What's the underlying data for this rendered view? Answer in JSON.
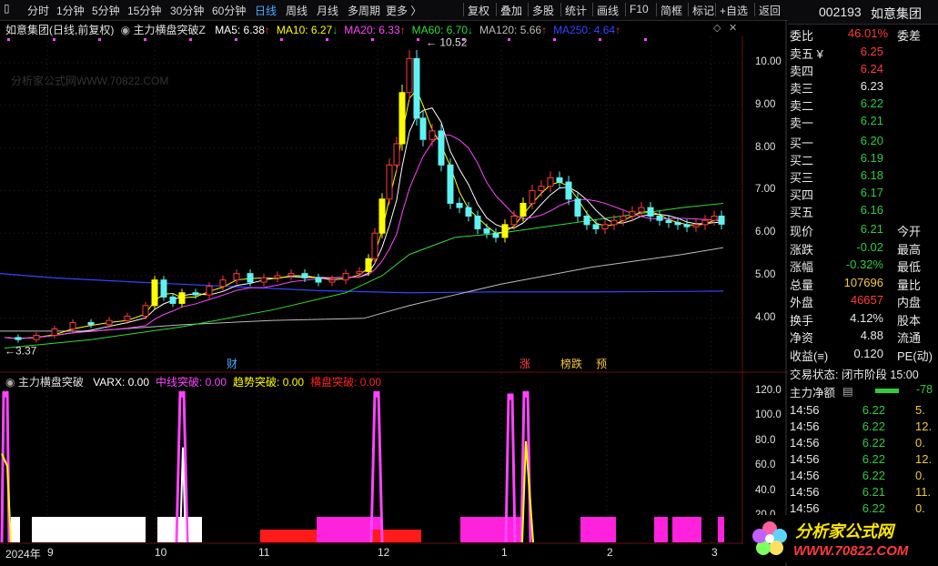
{
  "toolbar": {
    "items": [
      "分时",
      "1分钟",
      "5分钟",
      "15分钟",
      "30分钟",
      "60分钟",
      "日线",
      "周线",
      "月线",
      "多周期",
      "更多 〉"
    ],
    "active": "日线",
    "right_items": [
      "复权",
      "叠加",
      "多股",
      "统计",
      "画线",
      "F10",
      "简框",
      "标记",
      "+自选",
      "返回"
    ]
  },
  "stock": {
    "code": "002193",
    "name": "如意集团"
  },
  "main_chart": {
    "title": "如意集团(日线,前复权)",
    "indicator": "主力横盘突破Z",
    "ma": [
      {
        "label": "MA5: 6.38",
        "arrow": "↑",
        "color": "#ffffff"
      },
      {
        "label": "MA10: 6.27",
        "arrow": "↓",
        "color": "#ffff00"
      },
      {
        "label": "MA20: 6.33",
        "arrow": "↑",
        "color": "#ff44ff"
      },
      {
        "label": "MA60: 6.70",
        "arrow": "↓",
        "color": "#33dd33"
      },
      {
        "label": "MA120: 5.66",
        "arrow": "↑",
        "color": "#bbbbbb"
      },
      {
        "label": "MA250: 4.64",
        "arrow": "↑",
        "color": "#3344ff"
      }
    ],
    "watermark": "分析家公式网WWW.70822.COM",
    "high_label": "10.52",
    "low_label": "3.37",
    "markers": [
      {
        "text": "财",
        "color": "#4aa8ff"
      },
      {
        "text": "涨",
        "color": "#ff4444"
      },
      {
        "text": "榜跌",
        "color": "#f5c842"
      },
      {
        "text": "预",
        "color": "#f5c842"
      }
    ]
  },
  "price_axis": [
    "10.00",
    "9.00",
    "8.00",
    "7.00",
    "6.00",
    "5.00",
    "4.00"
  ],
  "sub_chart": {
    "name": "主力横盘突破",
    "items": [
      {
        "label": "VARX: 0.00",
        "color": "#ffffff"
      },
      {
        "label": "中线突破: 0.00",
        "color": "#ff44ff"
      },
      {
        "label": "趋势突破: 0.00",
        "color": "#ffff00"
      },
      {
        "label": "横盘突破: 0.00",
        "color": "#ff2222"
      }
    ],
    "axis": [
      "120.0",
      "100.0",
      "80.0",
      "60.0",
      "40.0",
      "20.0"
    ]
  },
  "date_axis": [
    "2024年",
    "9",
    "10",
    "11",
    "12",
    "1",
    "2",
    "3"
  ],
  "quote": {
    "webi_label": "委比",
    "webi_value": "46.01%",
    "weicha_label": "委差",
    "sells": [
      {
        "label": "卖五",
        "mark": "¥",
        "price": "6.25",
        "cls": "red"
      },
      {
        "label": "卖四",
        "mark": "",
        "price": "6.24",
        "cls": "red"
      },
      {
        "label": "卖三",
        "mark": "",
        "price": "6.23",
        "cls": "wht"
      },
      {
        "label": "卖二",
        "mark": "",
        "price": "6.22",
        "cls": "grn"
      },
      {
        "label": "卖一",
        "mark": "",
        "price": "6.21",
        "cls": "grn"
      }
    ],
    "buys": [
      {
        "label": "买一",
        "price": "6.20",
        "cls": "grn"
      },
      {
        "label": "买二",
        "price": "6.19",
        "cls": "grn"
      },
      {
        "label": "买三",
        "price": "6.18",
        "cls": "grn"
      },
      {
        "label": "买四",
        "price": "6.17",
        "cls": "grn"
      },
      {
        "label": "买五",
        "price": "6.16",
        "cls": "grn"
      }
    ],
    "stats": [
      {
        "label": "现价",
        "value": "6.21",
        "cls": "grn",
        "label2": "今开"
      },
      {
        "label": "涨跌",
        "value": "-0.02",
        "cls": "grn",
        "label2": "最高"
      },
      {
        "label": "涨幅",
        "value": "-0.32%",
        "cls": "grn",
        "label2": "最低"
      },
      {
        "label": "总量",
        "value": "107696",
        "cls": "yel",
        "label2": "量比"
      },
      {
        "label": "外盘",
        "value": "46657",
        "cls": "red",
        "label2": "内盘"
      },
      {
        "label": "换手",
        "value": "4.12%",
        "cls": "wht",
        "label2": "股本"
      },
      {
        "label": "净资",
        "value": "4.88",
        "cls": "wht",
        "label2": "流通"
      },
      {
        "label": "收益(≡)",
        "value": "0.120",
        "cls": "wht",
        "label2": "PE(动)"
      }
    ],
    "trade_state": "交易状态: 闭市阶段 15:00",
    "net_flow": "主力净额",
    "net_flow_value": "-78",
    "trades": [
      {
        "time": "14:56",
        "price": "6.22",
        "vol": "5."
      },
      {
        "time": "14:56",
        "price": "6.22",
        "vol": "12."
      },
      {
        "time": "14:56",
        "price": "6.22",
        "vol": "0."
      },
      {
        "time": "14:56",
        "price": "6.22",
        "vol": "12."
      },
      {
        "time": "14:56",
        "price": "6.22",
        "vol": "0."
      },
      {
        "time": "14:56",
        "price": "6.21",
        "vol": "11."
      },
      {
        "time": "14:56",
        "price": "6.22",
        "vol": "0."
      }
    ]
  },
  "logo": {
    "line1": "分析家公式网",
    "line2": "WWW.70822.COM"
  }
}
